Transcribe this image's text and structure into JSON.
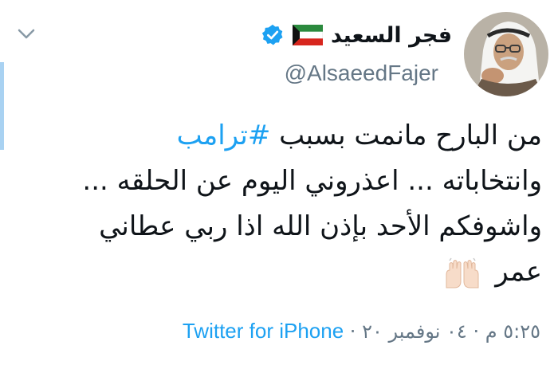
{
  "header": {
    "display_name": "فجر السعيد",
    "handle": "@AlsaeedFajer",
    "verified": true,
    "flag_icon": "kuwait-flag-icon"
  },
  "tweet": {
    "line1_text": "من البارح مانمت بسبب ",
    "hashtag": "#ترامب",
    "line2": "وانتخاباته ... اعذروني اليوم عن الحلقه ...",
    "line3": "واشوفكم الأحد بإذن الله اذا ربي عطاني",
    "line4_text": "عمر",
    "emoji": "raised-hands-icon"
  },
  "footer": {
    "time": "٥:٢٥ م",
    "separator": "·",
    "date": "٠٤ نوفمبر ٢٠",
    "source": "Twitter for iPhone"
  },
  "colors": {
    "link": "#1da1f2",
    "secondary_text": "#657786",
    "primary_text": "#0f1419",
    "verified": "#1da1f2"
  }
}
